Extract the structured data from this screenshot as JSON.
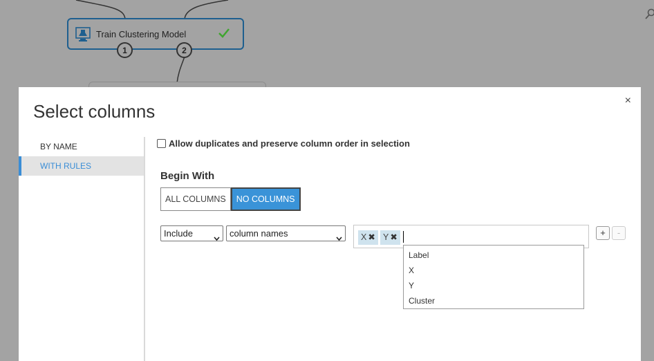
{
  "canvas": {
    "node": {
      "title": "Train Clustering Model",
      "port_1": "1",
      "port_2": "2",
      "status_icon": "checkmark-icon",
      "type_icon": "flask-icon"
    }
  },
  "modal": {
    "title": "Select columns",
    "close_label": "×",
    "sidebar": {
      "items": [
        {
          "label": "BY NAME",
          "active": false
        },
        {
          "label": "WITH RULES",
          "active": true
        }
      ]
    },
    "allow_duplicates": {
      "checked": false,
      "label": "Allow duplicates and preserve column order in selection"
    },
    "begin_with": {
      "label": "Begin With",
      "options": [
        "ALL COLUMNS",
        "NO COLUMNS"
      ],
      "selected": "NO COLUMNS"
    },
    "rule": {
      "mode": "Include",
      "criteria": "column names",
      "tags": [
        "X",
        "Y"
      ],
      "add_label": "+",
      "remove_label": "-"
    },
    "suggestions": [
      "Label",
      "X",
      "Y",
      "Cluster"
    ]
  },
  "colors": {
    "accent": "#3a93d8",
    "node_border": "#1e5f8f",
    "check": "#3fa52f",
    "canvas_bg": "#a3a3a3"
  }
}
